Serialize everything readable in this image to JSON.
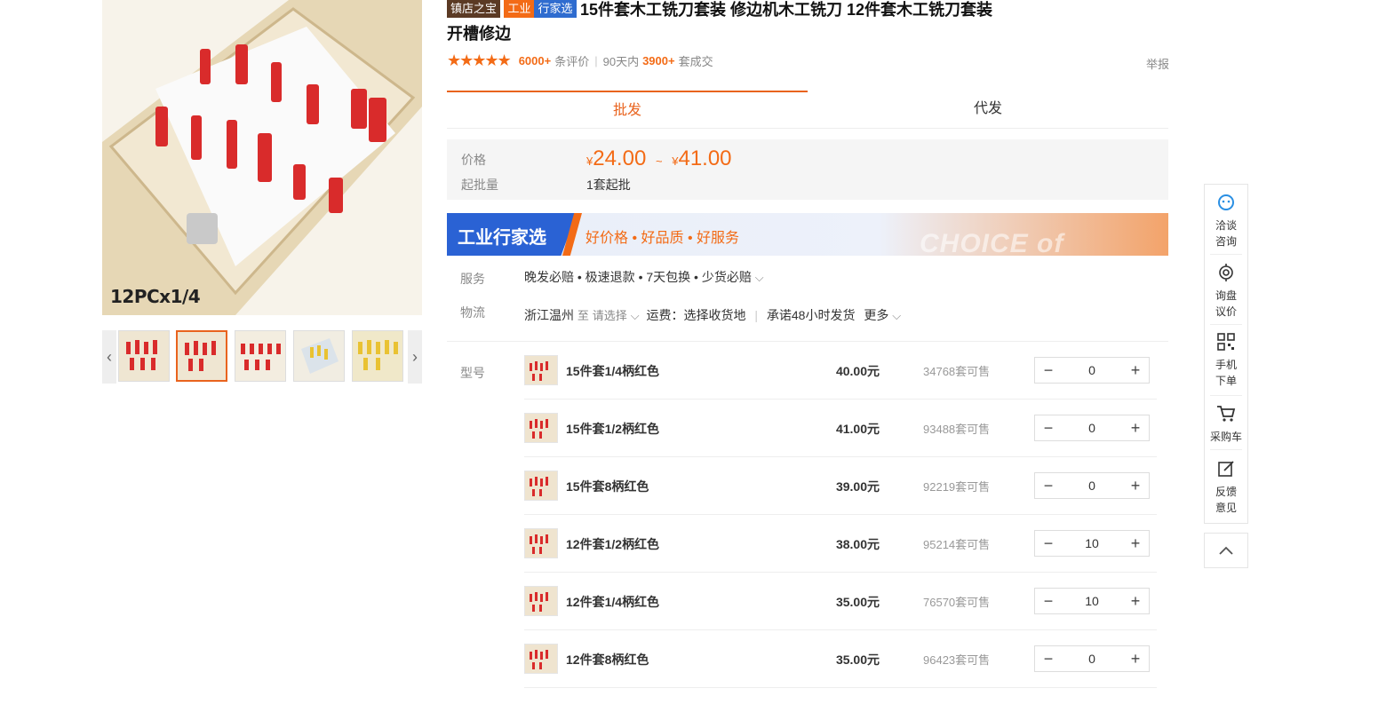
{
  "gallery": {
    "caption": "12PCx1/4",
    "prev_icon": "chevron-left-icon",
    "next_icon": "chevron-right-icon",
    "thumb_count": 5,
    "selected_thumb": 2
  },
  "title": {
    "badge_store": "镇店之宝",
    "badge_industry": "工业",
    "badge_expert": "行家选",
    "line1": "15件套木工铣刀套装 修边机木工铣刀 12件套木工铣刀套装",
    "line2": "开槽修边"
  },
  "rating": {
    "stars": "★★★★★",
    "reviews_count": "6000+",
    "reviews_label": "条评价",
    "period_label": "90天内",
    "sold_count": "3900+",
    "sold_label": "套成交",
    "report": "举报"
  },
  "tabs": {
    "wholesale": "批发",
    "dropship": "代发"
  },
  "price": {
    "label": "价格",
    "currency": "¥",
    "min": "24.00",
    "range_sep": "~",
    "max": "41.00",
    "moq_label": "起批量",
    "moq_value": "1套起批"
  },
  "banner": {
    "brand": "工业行家选",
    "slogan": "好价格 • 好品质 • 好服务",
    "english": "CHOICE of EXPERT"
  },
  "service": {
    "label": "服务",
    "value": "晚发必赔 • 极速退款 • 7天包换 • 少货必赔"
  },
  "logistics": {
    "label": "物流",
    "origin": "浙江温州",
    "to": "至",
    "select": "请选择",
    "freight": "运费：选择收货地",
    "promise": "承诺48小时发货",
    "more": "更多"
  },
  "sku": {
    "label": "型号",
    "rows": [
      {
        "name": "15件套1/4柄红色",
        "price": "40.00元",
        "stock": "34768套可售",
        "qty": "0"
      },
      {
        "name": "15件套1/2柄红色",
        "price": "41.00元",
        "stock": "93488套可售",
        "qty": "0"
      },
      {
        "name": "15件套8柄红色",
        "price": "39.00元",
        "stock": "92219套可售",
        "qty": "0"
      },
      {
        "name": "12件套1/2柄红色",
        "price": "38.00元",
        "stock": "95214套可售",
        "qty": "10"
      },
      {
        "name": "12件套1/4柄红色",
        "price": "35.00元",
        "stock": "76570套可售",
        "qty": "10"
      },
      {
        "name": "12件套8柄红色",
        "price": "35.00元",
        "stock": "96423套可售",
        "qty": "0"
      }
    ],
    "minus": "−",
    "plus": "+"
  },
  "toolbar": {
    "chat": "洽谈咨询",
    "inquiry": "询盘议价",
    "mobile": "手机下单",
    "cart": "采购车",
    "feedback": "反馈意见",
    "top_icon": "chevron-up-icon"
  },
  "colors": {
    "accent": "#e9631e",
    "price": "#f36b16",
    "expert_blue": "#2a62d4",
    "store_badge": "#5b3a24"
  }
}
